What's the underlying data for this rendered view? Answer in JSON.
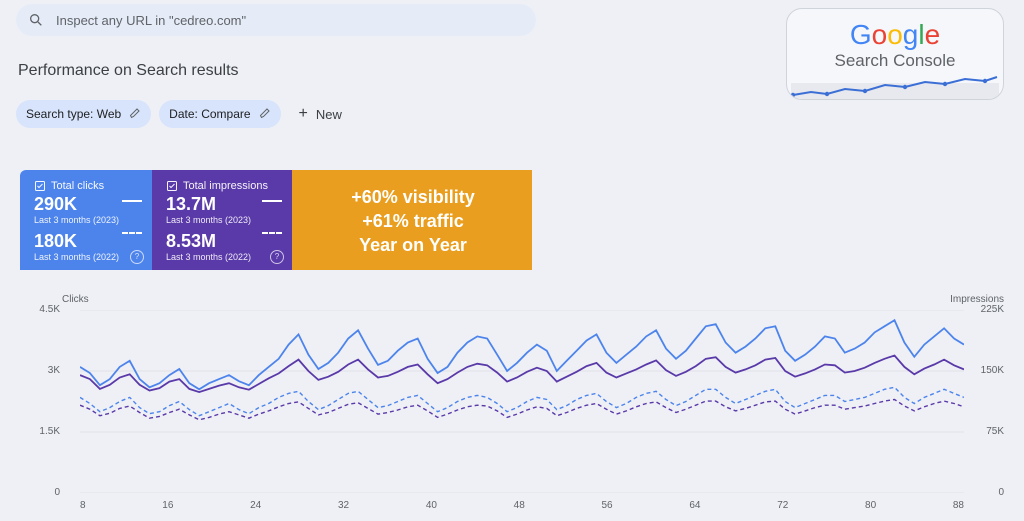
{
  "search": {
    "placeholder": "Inspect any URL in \"cedreo.com\""
  },
  "title": "Performance on Search results",
  "chips": {
    "type_label": "Search type: Web",
    "date_label": "Date: Compare",
    "new_label": "New"
  },
  "gsc": {
    "brand": "Google",
    "sub": "Search Console"
  },
  "cards": {
    "clicks": {
      "title": "Total clicks",
      "val_2023": "290K",
      "sub_2023": "Last 3 months (2023)",
      "val_2022": "180K",
      "sub_2022": "Last 3 months (2022)"
    },
    "impressions": {
      "title": "Total impressions",
      "val_2023": "13.7M",
      "sub_2023": "Last 3 months (2023)",
      "val_2022": "8.53M",
      "sub_2022": "Last 3 months (2022)"
    },
    "highlight": {
      "line1": "+60% visibility",
      "line2": "+61% traffic",
      "line3": "Year on Year"
    }
  },
  "chart_data": {
    "type": "line",
    "xlabel": "",
    "ylabel_left": "Clicks",
    "ylabel_right": "Impressions",
    "ylim_left": [
      0,
      4500
    ],
    "ylim_right": [
      0,
      225000
    ],
    "yticks_left": [
      "4.5K",
      "3K",
      "1.5K",
      "0"
    ],
    "yticks_right": [
      "225K",
      "150K",
      "75K",
      "0"
    ],
    "x": [
      1,
      2,
      3,
      4,
      5,
      6,
      7,
      8,
      9,
      10,
      11,
      12,
      13,
      14,
      15,
      16,
      17,
      18,
      19,
      20,
      21,
      22,
      23,
      24,
      25,
      26,
      27,
      28,
      29,
      30,
      31,
      32,
      33,
      34,
      35,
      36,
      37,
      38,
      39,
      40,
      41,
      42,
      43,
      44,
      45,
      46,
      47,
      48,
      49,
      50,
      51,
      52,
      53,
      54,
      55,
      56,
      57,
      58,
      59,
      60,
      61,
      62,
      63,
      64,
      65,
      66,
      67,
      68,
      69,
      70,
      71,
      72,
      73,
      74,
      75,
      76,
      77,
      78,
      79,
      80,
      81,
      82,
      83,
      84,
      85,
      86,
      87,
      88,
      89,
      90
    ],
    "xticks": [
      "8",
      "16",
      "24",
      "32",
      "40",
      "48",
      "56",
      "64",
      "72",
      "80",
      "88"
    ],
    "series": [
      {
        "name": "Clicks 2023",
        "axis": "left",
        "style": "solid",
        "color": "#4d84ec",
        "values": [
          3100,
          2950,
          2650,
          2800,
          3100,
          3250,
          2800,
          2600,
          2700,
          2900,
          3050,
          2700,
          2550,
          2700,
          2800,
          2900,
          2750,
          2650,
          2900,
          3100,
          3300,
          3650,
          3900,
          3400,
          3050,
          3200,
          3450,
          3800,
          4000,
          3550,
          3150,
          3250,
          3500,
          3700,
          3800,
          3300,
          2950,
          3100,
          3450,
          3700,
          3850,
          3800,
          3400,
          3000,
          3200,
          3450,
          3650,
          3500,
          3000,
          3250,
          3500,
          3750,
          3900,
          3450,
          3200,
          3400,
          3600,
          3850,
          4000,
          3550,
          3300,
          3500,
          3800,
          4100,
          4150,
          3700,
          3450,
          3600,
          3800,
          4050,
          4100,
          3500,
          3250,
          3400,
          3600,
          3850,
          3800,
          3450,
          3550,
          3700,
          3950,
          4100,
          4250,
          3700,
          3350,
          3650,
          3850,
          4050,
          3800,
          3650
        ]
      },
      {
        "name": "Impressions 2023",
        "axis": "right",
        "style": "solid",
        "color": "#5a39a8",
        "values": [
          145000,
          140000,
          128000,
          133000,
          142000,
          146000,
          133000,
          126000,
          129000,
          137000,
          140000,
          128000,
          124000,
          128000,
          132000,
          135000,
          130000,
          127000,
          134000,
          141000,
          147000,
          156000,
          164000,
          150000,
          139000,
          143000,
          149000,
          158000,
          164000,
          152000,
          142000,
          144000,
          149000,
          155000,
          158000,
          146000,
          135000,
          140000,
          148000,
          155000,
          159000,
          157000,
          148000,
          137000,
          142000,
          149000,
          154000,
          150000,
          137000,
          143000,
          149000,
          156000,
          160000,
          148000,
          142000,
          147000,
          152000,
          158000,
          163000,
          151000,
          144000,
          149000,
          156000,
          165000,
          167000,
          155000,
          148000,
          152000,
          157000,
          164000,
          166000,
          150000,
          143000,
          147000,
          152000,
          158000,
          157000,
          148000,
          150000,
          154000,
          160000,
          165000,
          169000,
          155000,
          146000,
          153000,
          158000,
          164000,
          157000,
          152000
        ]
      },
      {
        "name": "Clicks 2022",
        "axis": "left",
        "style": "dashed",
        "color": "#4d84ec",
        "values": [
          2350,
          2200,
          2000,
          2100,
          2250,
          2350,
          2100,
          1950,
          2000,
          2150,
          2250,
          2050,
          1900,
          2000,
          2100,
          2200,
          2050,
          1950,
          2100,
          2200,
          2350,
          2450,
          2500,
          2250,
          2050,
          2150,
          2300,
          2450,
          2500,
          2300,
          2100,
          2150,
          2250,
          2350,
          2400,
          2200,
          2000,
          2100,
          2250,
          2350,
          2400,
          2350,
          2200,
          2000,
          2100,
          2250,
          2350,
          2300,
          2050,
          2150,
          2300,
          2400,
          2450,
          2250,
          2100,
          2200,
          2350,
          2450,
          2500,
          2300,
          2150,
          2250,
          2400,
          2550,
          2550,
          2350,
          2200,
          2300,
          2400,
          2500,
          2550,
          2250,
          2100,
          2200,
          2300,
          2400,
          2400,
          2250,
          2300,
          2350,
          2450,
          2550,
          2600,
          2350,
          2200,
          2350,
          2450,
          2550,
          2450,
          2350
        ]
      },
      {
        "name": "Impressions 2022",
        "axis": "right",
        "style": "dashed",
        "color": "#5a39a8",
        "values": [
          108000,
          103000,
          95000,
          98000,
          104000,
          107000,
          99000,
          92000,
          94000,
          99000,
          103000,
          96000,
          90000,
          93000,
          97000,
          100000,
          96000,
          92000,
          97000,
          101000,
          106000,
          110000,
          112000,
          104000,
          96000,
          99000,
          104000,
          109000,
          111000,
          104000,
          97000,
          99000,
          102000,
          106000,
          108000,
          101000,
          93000,
          97000,
          102000,
          106000,
          108000,
          107000,
          101000,
          93000,
          97000,
          102000,
          106000,
          104000,
          95000,
          99000,
          104000,
          108000,
          110000,
          103000,
          97000,
          101000,
          106000,
          110000,
          112000,
          105000,
          99000,
          103000,
          108000,
          113000,
          113000,
          106000,
          101000,
          104000,
          108000,
          112000,
          113000,
          103000,
          97000,
          101000,
          105000,
          108000,
          108000,
          103000,
          105000,
          107000,
          110000,
          113000,
          115000,
          107000,
          101000,
          106000,
          110000,
          113000,
          110000,
          106000
        ]
      }
    ]
  }
}
